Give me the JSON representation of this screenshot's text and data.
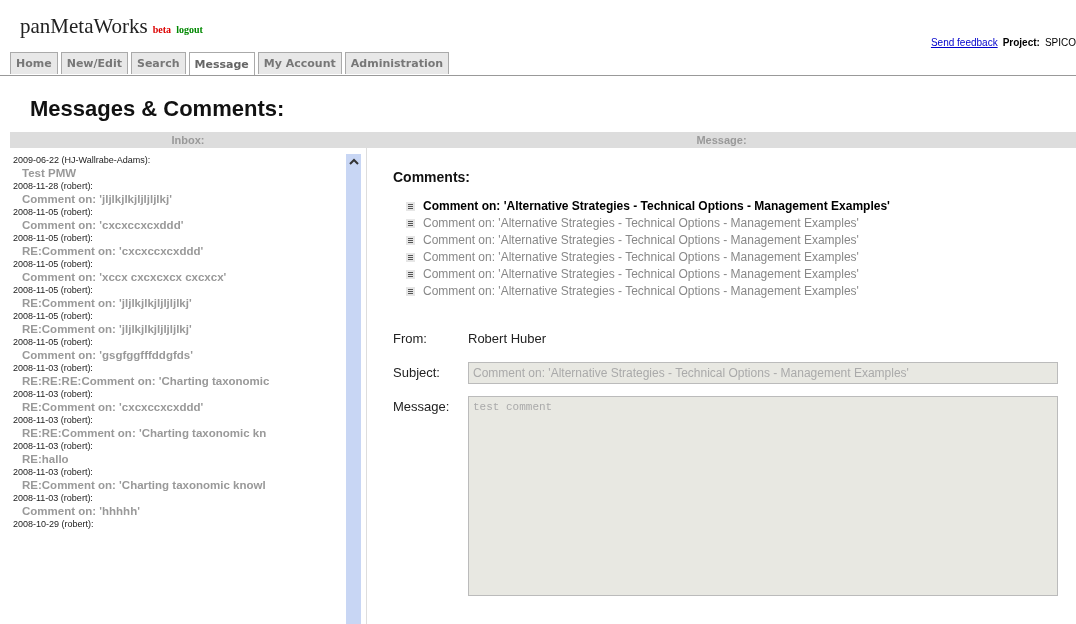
{
  "header": {
    "app_name": "panMetaWorks",
    "beta": "beta",
    "logout": "logout",
    "feedback_link": "Send feedback",
    "project_label": "Project:",
    "project_value": "SPICO"
  },
  "tabs": [
    {
      "label": "Home",
      "selected": false
    },
    {
      "label": "New/Edit",
      "selected": false
    },
    {
      "label": "Search",
      "selected": false
    },
    {
      "label": "Message",
      "selected": true
    },
    {
      "label": "My Account",
      "selected": false
    },
    {
      "label": "Administration",
      "selected": false
    }
  ],
  "page_title": "Messages & Comments:",
  "inbox": {
    "title": "Inbox:",
    "items": [
      {
        "meta": "2009-06-22 (HJ-Wallrabe-Adams):",
        "subject": "Test PMW"
      },
      {
        "meta": "2008-11-28 (robert):",
        "subject": "Comment on: 'jljlkjlkjljljljlkj'"
      },
      {
        "meta": "2008-11-05 (robert):",
        "subject": "Comment on: 'cxcxccxcxddd'"
      },
      {
        "meta": "2008-11-05 (robert):",
        "subject": "RE:Comment on: 'cxcxccxcxddd'"
      },
      {
        "meta": "2008-11-05 (robert):",
        "subject": "Comment on: 'xccx cxcxcxcx cxcxcx'"
      },
      {
        "meta": "2008-11-05 (robert):",
        "subject": "RE:Comment on: 'jljlkjlkjljljljlkj'"
      },
      {
        "meta": "2008-11-05 (robert):",
        "subject": "RE:Comment on: 'jljlkjlkjljljljlkj'"
      },
      {
        "meta": "2008-11-05 (robert):",
        "subject": "Comment on: 'gsgfggfffddgfds'"
      },
      {
        "meta": "2008-11-03 (robert):",
        "subject": "RE:RE:RE:Comment on: 'Charting taxonomic"
      },
      {
        "meta": "2008-11-03 (robert):",
        "subject": "RE:Comment on: 'cxcxccxcxddd'"
      },
      {
        "meta": "2008-11-03 (robert):",
        "subject": "RE:RE:Comment on: 'Charting taxonomic kn"
      },
      {
        "meta": "2008-11-03 (robert):",
        "subject": "RE:hallo"
      },
      {
        "meta": "2008-11-03 (robert):",
        "subject": "RE:Comment on: 'Charting taxonomic knowl"
      },
      {
        "meta": "2008-11-03 (robert):",
        "subject": "Comment on: 'hhhhh'"
      },
      {
        "meta": "2008-10-29 (robert):"
      }
    ]
  },
  "message": {
    "title": "Message:",
    "comments_heading": "Comments:",
    "comments": [
      {
        "text": "Comment on: 'Alternative Strategies - Technical Options - Management Examples'",
        "selected": true
      },
      {
        "text": "Comment on: 'Alternative Strategies - Technical Options - Management Examples'",
        "selected": false
      },
      {
        "text": "Comment on: 'Alternative Strategies - Technical Options - Management Examples'",
        "selected": false
      },
      {
        "text": "Comment on: 'Alternative Strategies - Technical Options - Management Examples'",
        "selected": false
      },
      {
        "text": "Comment on: 'Alternative Strategies - Technical Options - Management Examples'",
        "selected": false
      },
      {
        "text": "Comment on: 'Alternative Strategies - Technical Options - Management Examples'",
        "selected": false
      }
    ],
    "from_label": "From:",
    "from_value": "Robert Huber",
    "subject_label": "Subject:",
    "subject_value": "Comment on: 'Alternative Strategies - Technical Options - Management Examples'",
    "message_label": "Message:",
    "message_value": "test comment",
    "disabled": true
  }
}
